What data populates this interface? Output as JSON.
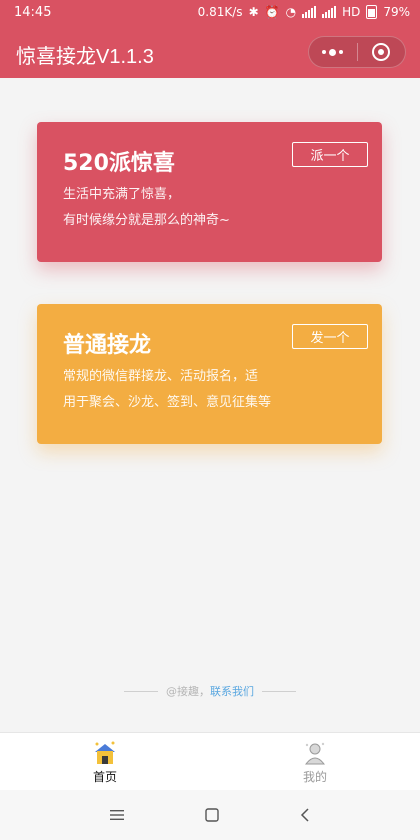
{
  "status_bar": {
    "time": "14:45",
    "speed": "0.81K/s",
    "network": "HD",
    "battery": "79%"
  },
  "navbar": {
    "title": "惊喜接龙V1.1.3"
  },
  "cards": [
    {
      "title": "520派惊喜",
      "desc_line1": "生活中充满了惊喜，",
      "desc_line2": "有时候缘分就是那么的神奇~",
      "button": "派一个",
      "color": "#d95262"
    },
    {
      "title": "普通接龙",
      "desc_line1": "常规的微信群接龙、活动报名，适",
      "desc_line2": "用于聚会、沙龙、签到、意见征集等",
      "button": "发一个",
      "color": "#f3ad42"
    }
  ],
  "footer": {
    "prefix": "@接趣，",
    "link": "联系我们"
  },
  "tabbar": {
    "tabs": [
      {
        "label": "首页",
        "icon": "home-icon",
        "active": true
      },
      {
        "label": "我的",
        "icon": "profile-icon",
        "active": false
      }
    ]
  },
  "theme": {
    "primary": "#d95262",
    "secondary": "#f3ad42",
    "link": "#5aa7e0"
  }
}
